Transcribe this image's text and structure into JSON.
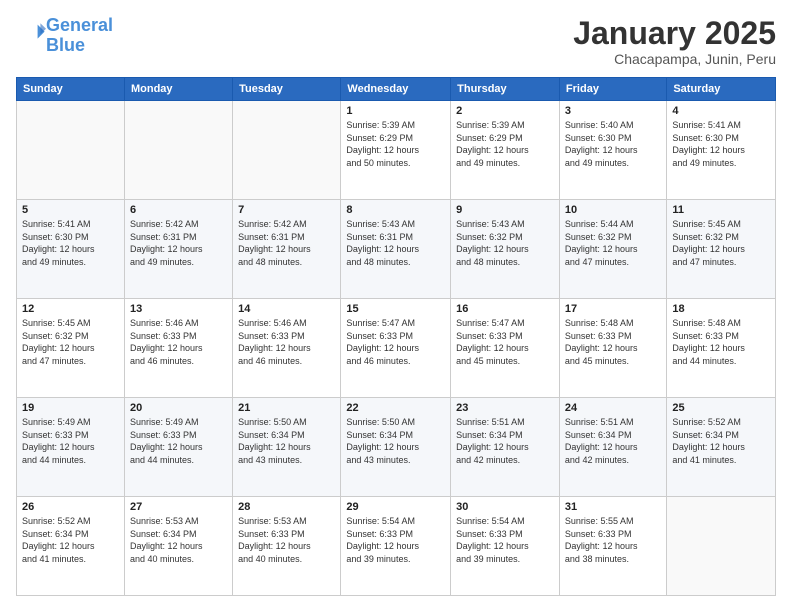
{
  "header": {
    "logo_line1": "General",
    "logo_line2": "Blue",
    "month_year": "January 2025",
    "location": "Chacapampa, Junin, Peru"
  },
  "weekdays": [
    "Sunday",
    "Monday",
    "Tuesday",
    "Wednesday",
    "Thursday",
    "Friday",
    "Saturday"
  ],
  "weeks": [
    [
      {
        "day": "",
        "info": ""
      },
      {
        "day": "",
        "info": ""
      },
      {
        "day": "",
        "info": ""
      },
      {
        "day": "1",
        "info": "Sunrise: 5:39 AM\nSunset: 6:29 PM\nDaylight: 12 hours\nand 50 minutes."
      },
      {
        "day": "2",
        "info": "Sunrise: 5:39 AM\nSunset: 6:29 PM\nDaylight: 12 hours\nand 49 minutes."
      },
      {
        "day": "3",
        "info": "Sunrise: 5:40 AM\nSunset: 6:30 PM\nDaylight: 12 hours\nand 49 minutes."
      },
      {
        "day": "4",
        "info": "Sunrise: 5:41 AM\nSunset: 6:30 PM\nDaylight: 12 hours\nand 49 minutes."
      }
    ],
    [
      {
        "day": "5",
        "info": "Sunrise: 5:41 AM\nSunset: 6:30 PM\nDaylight: 12 hours\nand 49 minutes."
      },
      {
        "day": "6",
        "info": "Sunrise: 5:42 AM\nSunset: 6:31 PM\nDaylight: 12 hours\nand 49 minutes."
      },
      {
        "day": "7",
        "info": "Sunrise: 5:42 AM\nSunset: 6:31 PM\nDaylight: 12 hours\nand 48 minutes."
      },
      {
        "day": "8",
        "info": "Sunrise: 5:43 AM\nSunset: 6:31 PM\nDaylight: 12 hours\nand 48 minutes."
      },
      {
        "day": "9",
        "info": "Sunrise: 5:43 AM\nSunset: 6:32 PM\nDaylight: 12 hours\nand 48 minutes."
      },
      {
        "day": "10",
        "info": "Sunrise: 5:44 AM\nSunset: 6:32 PM\nDaylight: 12 hours\nand 47 minutes."
      },
      {
        "day": "11",
        "info": "Sunrise: 5:45 AM\nSunset: 6:32 PM\nDaylight: 12 hours\nand 47 minutes."
      }
    ],
    [
      {
        "day": "12",
        "info": "Sunrise: 5:45 AM\nSunset: 6:32 PM\nDaylight: 12 hours\nand 47 minutes."
      },
      {
        "day": "13",
        "info": "Sunrise: 5:46 AM\nSunset: 6:33 PM\nDaylight: 12 hours\nand 46 minutes."
      },
      {
        "day": "14",
        "info": "Sunrise: 5:46 AM\nSunset: 6:33 PM\nDaylight: 12 hours\nand 46 minutes."
      },
      {
        "day": "15",
        "info": "Sunrise: 5:47 AM\nSunset: 6:33 PM\nDaylight: 12 hours\nand 46 minutes."
      },
      {
        "day": "16",
        "info": "Sunrise: 5:47 AM\nSunset: 6:33 PM\nDaylight: 12 hours\nand 45 minutes."
      },
      {
        "day": "17",
        "info": "Sunrise: 5:48 AM\nSunset: 6:33 PM\nDaylight: 12 hours\nand 45 minutes."
      },
      {
        "day": "18",
        "info": "Sunrise: 5:48 AM\nSunset: 6:33 PM\nDaylight: 12 hours\nand 44 minutes."
      }
    ],
    [
      {
        "day": "19",
        "info": "Sunrise: 5:49 AM\nSunset: 6:33 PM\nDaylight: 12 hours\nand 44 minutes."
      },
      {
        "day": "20",
        "info": "Sunrise: 5:49 AM\nSunset: 6:33 PM\nDaylight: 12 hours\nand 44 minutes."
      },
      {
        "day": "21",
        "info": "Sunrise: 5:50 AM\nSunset: 6:34 PM\nDaylight: 12 hours\nand 43 minutes."
      },
      {
        "day": "22",
        "info": "Sunrise: 5:50 AM\nSunset: 6:34 PM\nDaylight: 12 hours\nand 43 minutes."
      },
      {
        "day": "23",
        "info": "Sunrise: 5:51 AM\nSunset: 6:34 PM\nDaylight: 12 hours\nand 42 minutes."
      },
      {
        "day": "24",
        "info": "Sunrise: 5:51 AM\nSunset: 6:34 PM\nDaylight: 12 hours\nand 42 minutes."
      },
      {
        "day": "25",
        "info": "Sunrise: 5:52 AM\nSunset: 6:34 PM\nDaylight: 12 hours\nand 41 minutes."
      }
    ],
    [
      {
        "day": "26",
        "info": "Sunrise: 5:52 AM\nSunset: 6:34 PM\nDaylight: 12 hours\nand 41 minutes."
      },
      {
        "day": "27",
        "info": "Sunrise: 5:53 AM\nSunset: 6:34 PM\nDaylight: 12 hours\nand 40 minutes."
      },
      {
        "day": "28",
        "info": "Sunrise: 5:53 AM\nSunset: 6:33 PM\nDaylight: 12 hours\nand 40 minutes."
      },
      {
        "day": "29",
        "info": "Sunrise: 5:54 AM\nSunset: 6:33 PM\nDaylight: 12 hours\nand 39 minutes."
      },
      {
        "day": "30",
        "info": "Sunrise: 5:54 AM\nSunset: 6:33 PM\nDaylight: 12 hours\nand 39 minutes."
      },
      {
        "day": "31",
        "info": "Sunrise: 5:55 AM\nSunset: 6:33 PM\nDaylight: 12 hours\nand 38 minutes."
      },
      {
        "day": "",
        "info": ""
      }
    ]
  ]
}
